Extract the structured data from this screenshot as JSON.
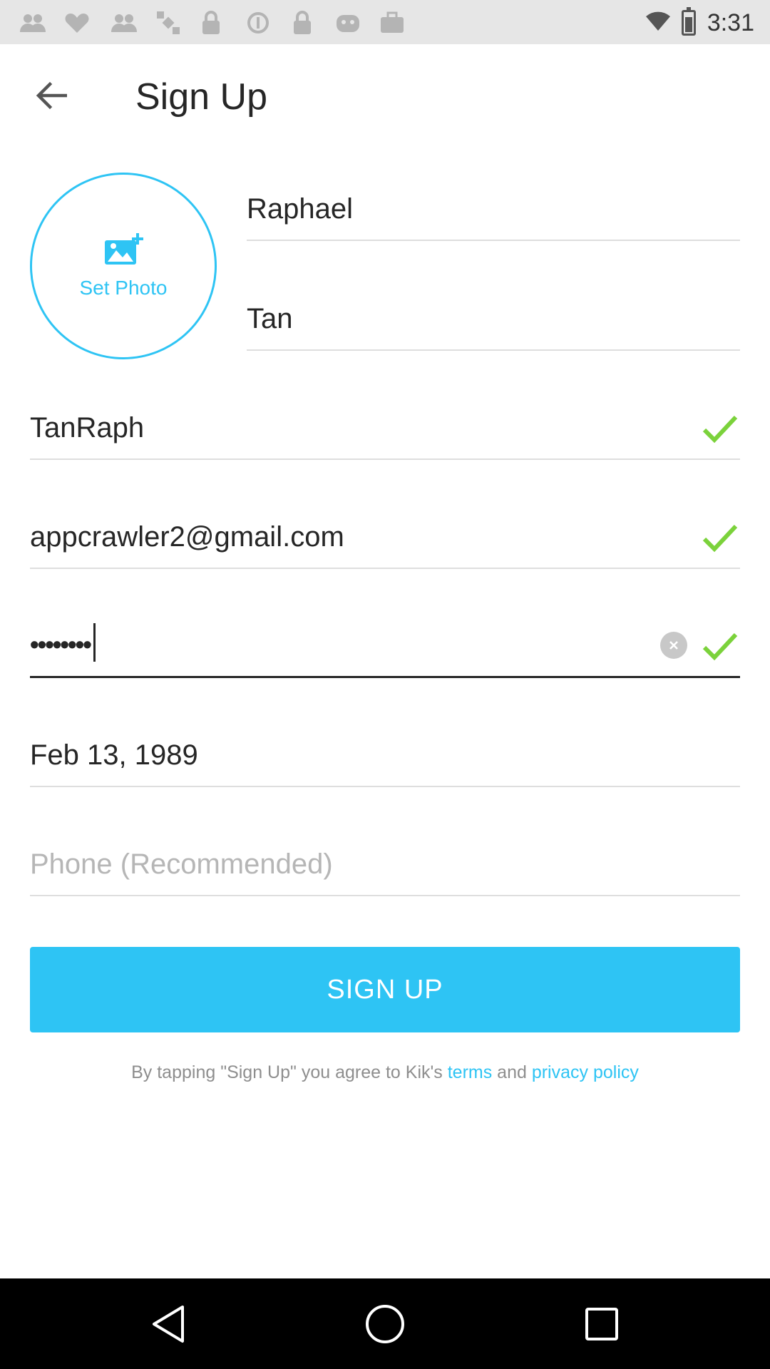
{
  "app": {
    "title": "Sign Up",
    "accent_color": "#2ec4f4",
    "check_color": "#7bd23b"
  },
  "status_bar": {
    "time": "3:31",
    "notification_icons": [
      "people-icon",
      "heart-icon",
      "people-icon",
      "satellite-icon",
      "lock-icon",
      "block-icon",
      "lock-icon",
      "emoji-icon",
      "briefcase-icon"
    ],
    "right_icons": [
      "wifi-icon",
      "battery-icon"
    ]
  },
  "header": {
    "back_icon": "arrow-left-icon",
    "title": "Sign Up"
  },
  "photo": {
    "icon": "add-photo-icon",
    "label": "Set Photo"
  },
  "form": {
    "first_name": "Raphael",
    "last_name": "Tan",
    "username": "TanRaph",
    "email": "appcrawler2@gmail.com",
    "password_masked": "••••••••",
    "birthday": "Feb 13, 1989",
    "phone_placeholder": "Phone (Recommended)"
  },
  "signup_button": {
    "label": "SIGN UP"
  },
  "terms": {
    "prefix": "By tapping \"Sign Up\" you agree to Kik's ",
    "terms_link": "terms",
    "middle": " and ",
    "privacy_link": "privacy policy"
  },
  "nav_bar": {
    "buttons": [
      "back-triangle-icon",
      "home-circle-icon",
      "recents-square-icon"
    ]
  }
}
